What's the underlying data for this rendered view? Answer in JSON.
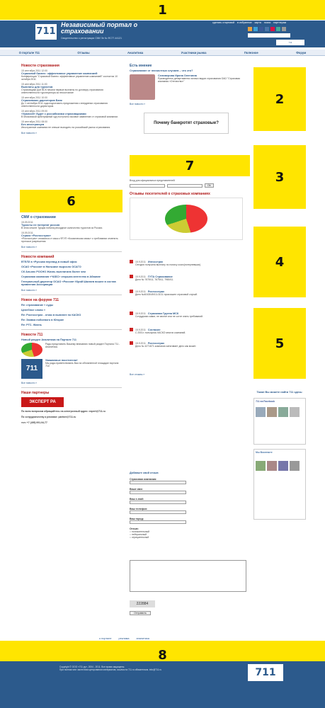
{
  "site": {
    "logo_text": "711",
    "title": "Независимый портал о страховании",
    "cert": "Свидетельство о регистрации СМИ Эл № ФС77-44121"
  },
  "toplinks": [
    "сделать стартовой",
    "в избранное",
    "карта",
    "поиск",
    "партнерам"
  ],
  "nav": [
    "О портале 711",
    "Отзывы",
    "Аналитика",
    "Участники рынка",
    "Полезное",
    "Форум"
  ],
  "markers": [
    "1",
    "2",
    "3",
    "4",
    "5",
    "6",
    "7",
    "8"
  ],
  "left": {
    "news_title": "Новости страхования",
    "news": [
      {
        "date": "15 сентября 2011 12:00",
        "title": "Страховой бизнес: эффективное управление компанией",
        "text": "Конференция \"Страховой бизнес: эффективное управление компанией\" состоится 10 октября 2011."
      },
      {
        "date": "15 сентября 2011 11:00",
        "title": "Выплаты для туристов",
        "text": "Страховщики Дон ВСК начали первые выплаты по договору страхования ответственности туроператора за несостояние"
      },
      {
        "date": "15 сентября 2011 10:00",
        "title": "Страхование директоров Банк",
        "text": "До 1 сентября 2011 года подготовить предложения о внедрении страхования ответственности директоров."
      },
      {
        "date": "15 сентября 2011 09:00",
        "title": "«Уралсиб» будет с российскими страховщиками",
        "text": "В Московской арбитражный суд поступило исковое заявление от страховой компании."
      },
      {
        "date": "15 сентября 2011 08:00",
        "title": "Без иностранцев",
        "text": "Иностранные компании не спешат выходить на российский рынок страхования."
      }
    ],
    "more": "Все новости »",
    "smi_title": "СМИ о страховании",
    "smi": [
      {
        "date": "15.09.2011",
        "title": "Туристы не потерпят россия",
        "text": "В этом сезоне Турция побила рекордное количество туристов из России."
      },
      {
        "date": "15.09.2011",
        "title": "Страхи «Росгосстрах»",
        "text": "«Росгосстрах» отказался от иска к ФТУП «Космическая связь» о требовании отменить протокол разрешения"
      }
    ],
    "company_title": "Новости компаний",
    "company_news": [
      "ЕГЕЛЗ в «Русская перевод в новый офис",
      "ОСАО «Россия» в Нальчике выросло ОСАГО",
      "СК Альянс РОСНО Жизнь выплатила более чем",
      "Страховая компания «ЧАБС» открыла агентство в Абакане",
      "Генеральный директор ОСАО «Россия» Юрий Шалаев вошел в состав правления Ассоциации"
    ],
    "forum_title": "Новое на форуме 711",
    "forum": [
      "Re: страхование « суды",
      "Целебное слово »",
      "Re: Росгосстрах - отказ в выплате по КАСКО",
      "Re: Заявка побоевого в Югорие",
      "Re: РГС. Жизнь"
    ],
    "news711_title": "Новости 711",
    "news711": [
      {
        "title": "Новый раздел Аналитика на Портале 711",
        "text": "Рады представить Вашему вниманию новый раздел Портала 711 - Аналитика."
      },
      {
        "title": "Уважаемые посетители!",
        "text": "Мы рады приветствовать Вас на обновленной площадке портала 711!"
      }
    ],
    "partners_title": "Наши партнеры",
    "partner_logo": "ЭКСПЕРТ РА",
    "contacts": [
      "По всем вопросам обращайтесь на электронный адрес: expert@711.ru",
      "По сотрудничеству и рекламе: partner@711.ru",
      "тел: +7 (495) 991-94-77"
    ]
  },
  "center": {
    "opinion_title": "Есть мнение",
    "opinion_q": "Страхование от несчастных случаев – что это?",
    "person": "Селиверова Ирина Олеговна",
    "person_role": "Руководитель департамента личных видов страхования ОАО \"Страховая компания «Отечество»\"",
    "banner": "Почему банкротят страховые?",
    "login_title": "Вход для официальных представителей",
    "login_ph": "Логин",
    "ok": "Ok",
    "reviews_title": "Отзывы посетителей о страховых компаниях",
    "reviews": [
      {
        "date": "15.9.2011",
        "company": "Ингосстрах",
        "text": "Сегодня получила выплату по полису осаго(потерпевшая)."
      },
      {
        "date": "15.9.2011",
        "company": "ГУТА Страхование",
        "text": "Дело № 7675/11, 7675/11, 7980/11."
      },
      {
        "date": "15.9.2011",
        "company": "Росгосстрах",
        "text": "Дело №4043049/13-01/11 произошел страховой случай."
      },
      {
        "date": "15.9.2011",
        "company": "Страховая Группа МСК",
        "text": "Сотрудники хамят, не звонят или не сотят знать требований."
      },
      {
        "date": "15.9.2011",
        "company": "Согласие",
        "text": "С 2001г. пользуюсь КАСКО многих компаний."
      },
      {
        "date": "15.9.2011",
        "company": "Росгосстрах",
        "text": "Дело № 4271671 компания затягивает дело как может."
      }
    ],
    "more": "Все отзывы »",
    "add_title": "Добавьте свой отзыв",
    "fields": [
      "Страховая компания:",
      "Ваше имя:",
      "Ваш e-mail:",
      "Ваш телефон:",
      "Ваш город:",
      "Отзыв:"
    ],
    "ratings": [
      "положительный",
      "нейтральный",
      "отрицательный"
    ],
    "captcha": "222884",
    "submit": "Отправить"
  },
  "right": {
    "fb_title": "Также Вы можете найти 711 здесь:",
    "fb_name": "711 на Facebook",
    "vk_title": "Мы Вконтакте"
  },
  "footer": {
    "links": [
      "о портале",
      "реклама",
      "аналитика"
    ],
    "copyright": "Copyright © ООО «711.ру», 2004 - 2011. Все права защищены.",
    "text": "При полном или частичном цитировании материалов, ссылка на 711.ru обязательна. info@711.ru",
    "logo_text": "711"
  }
}
